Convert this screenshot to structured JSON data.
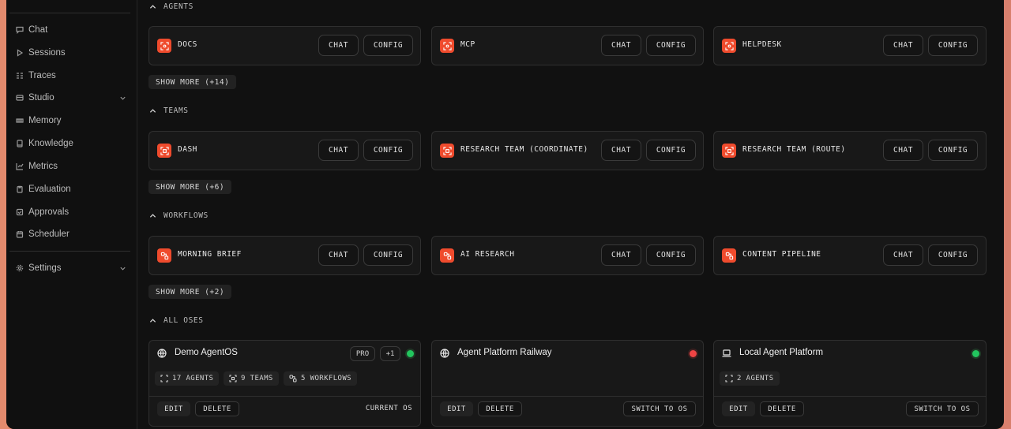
{
  "sidebar": {
    "items": [
      {
        "label": "Chat",
        "icon": "chat-icon"
      },
      {
        "label": "Sessions",
        "icon": "play-icon"
      },
      {
        "label": "Traces",
        "icon": "traces-icon"
      },
      {
        "label": "Studio",
        "icon": "studio-icon",
        "expandable": true
      },
      {
        "label": "Memory",
        "icon": "memory-icon"
      },
      {
        "label": "Knowledge",
        "icon": "book-icon"
      },
      {
        "label": "Metrics",
        "icon": "chart-icon"
      },
      {
        "label": "Evaluation",
        "icon": "clipboard-icon"
      },
      {
        "label": "Approvals",
        "icon": "check-icon"
      },
      {
        "label": "Scheduler",
        "icon": "calendar-icon"
      }
    ],
    "settings": {
      "label": "Settings",
      "icon": "gear-icon"
    }
  },
  "sections": {
    "agents": {
      "title": "AGENTS",
      "cards": [
        {
          "name": "DOCS"
        },
        {
          "name": "MCP"
        },
        {
          "name": "HELPDESK"
        }
      ],
      "show_more": "SHOW MORE (+14)"
    },
    "teams": {
      "title": "TEAMS",
      "cards": [
        {
          "name": "DASH"
        },
        {
          "name": "RESEARCH TEAM (COORDINATE)"
        },
        {
          "name": "RESEARCH TEAM (ROUTE)"
        }
      ],
      "show_more": "SHOW MORE (+6)"
    },
    "workflows": {
      "title": "WORKFLOWS",
      "cards": [
        {
          "name": "MORNING BRIEF"
        },
        {
          "name": "AI RESEARCH"
        },
        {
          "name": "CONTENT PIPELINE"
        }
      ],
      "show_more": "SHOW MORE (+2)"
    },
    "oses": {
      "title": "ALL OSES"
    }
  },
  "buttons": {
    "chat": "CHAT",
    "config": "CONFIG",
    "edit": "EDIT",
    "delete": "DELETE",
    "switch": "SWITCH TO OS"
  },
  "os_cards": [
    {
      "name": "Demo AgentOS",
      "icon": "globe-icon",
      "status_color": "#22c55e",
      "pill_pro": "PRO",
      "pill_more": "+1",
      "chips": {
        "agents": "17 AGENTS",
        "teams": "9 TEAMS",
        "workflows": "5 WORKFLOWS"
      },
      "status_text": "CURRENT OS"
    },
    {
      "name": "Agent Platform Railway",
      "icon": "globe-icon",
      "status_color": "#ef4444"
    },
    {
      "name": "Local Agent Platform",
      "icon": "laptop-icon",
      "status_color": "#22c55e",
      "chips": {
        "agents": "2 AGENTS"
      }
    }
  ],
  "colors": {
    "accent": "#ef4b2d",
    "background": "#111111",
    "card": "#181818"
  }
}
